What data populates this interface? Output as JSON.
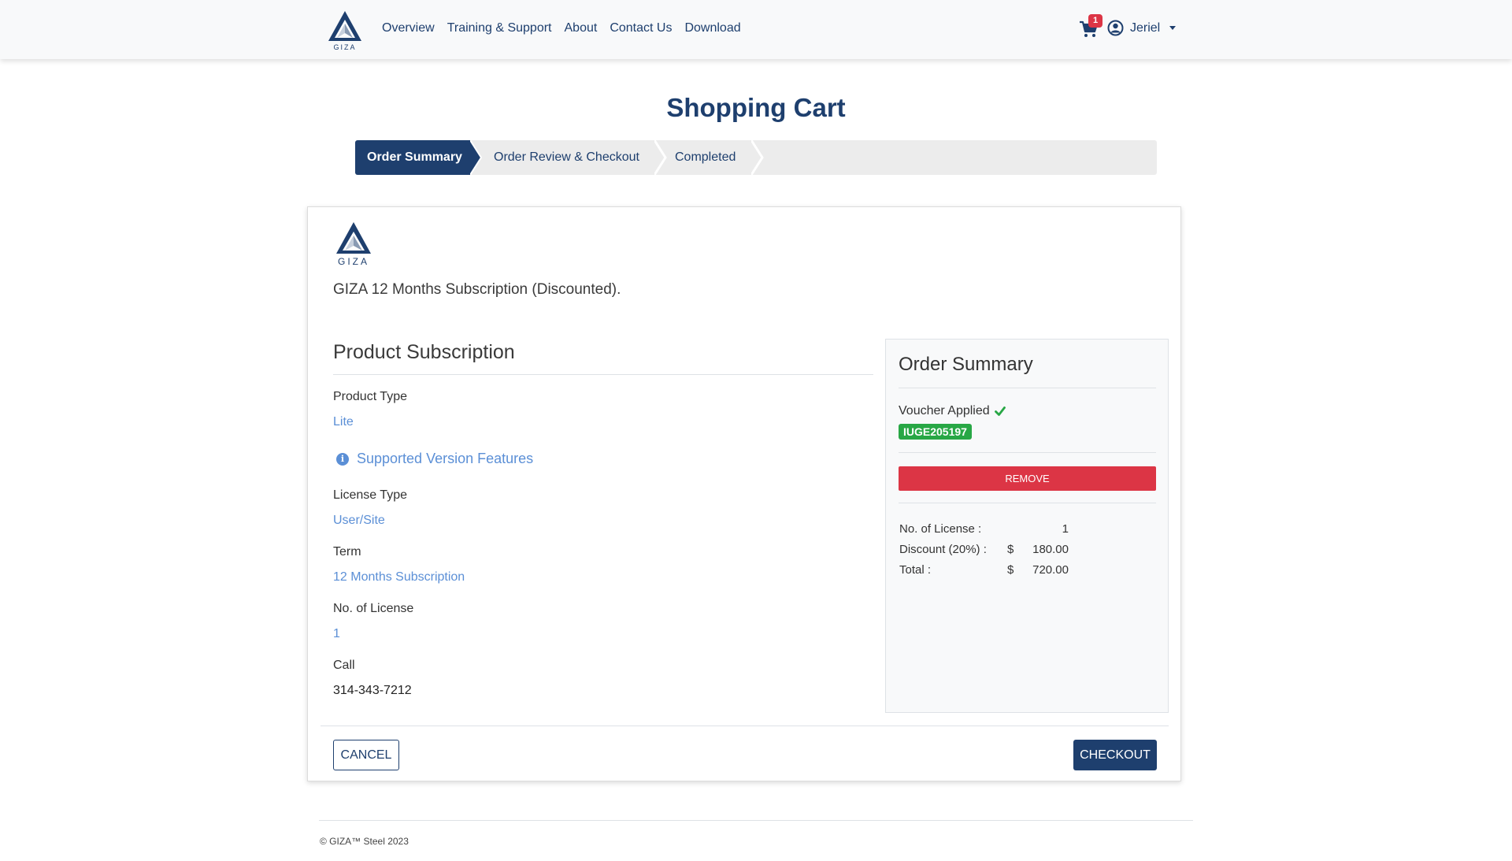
{
  "nav": {
    "brand": "GIZA",
    "links": [
      "Overview",
      "Training & Support",
      "About",
      "Contact Us",
      "Download"
    ],
    "cart_count": "1",
    "user_name": "Jeriel"
  },
  "page": {
    "title": "Shopping Cart"
  },
  "steps": [
    "Order Summary",
    "Order Review & Checkout",
    "Completed"
  ],
  "product": {
    "brand": "GIZA",
    "name": "GIZA 12 Months Subscription (Discounted).",
    "section_title": "Product Subscription",
    "product_type_label": "Product Type",
    "product_type_value": "Lite",
    "features_link": "Supported Version Features",
    "license_type_label": "License Type",
    "license_type_value": "User/Site",
    "term_label": "Term",
    "term_value": "12 Months Subscription",
    "licenses_label": "No. of License",
    "licenses_value": "1",
    "call_label": "Call",
    "call_value": "314-343-7212"
  },
  "summary": {
    "title": "Order Summary",
    "voucher_label": "Voucher Applied",
    "voucher_code": "IUGE205197",
    "remove_label": "REMOVE",
    "rows": [
      {
        "label": "No. of License :",
        "currency": "",
        "value": "1"
      },
      {
        "label": "Discount (20%) :",
        "currency": "$",
        "value": "180.00"
      },
      {
        "label": "Total :",
        "currency": "$",
        "value": "720.00"
      }
    ]
  },
  "actions": {
    "cancel": "CANCEL",
    "checkout": "CHECKOUT"
  },
  "footer": {
    "copyright": "© GIZA™ Steel 2023"
  },
  "colors": {
    "primary": "#1e3f6e",
    "link": "#5b8fd6",
    "danger": "#dc3545",
    "success": "#28a745"
  }
}
